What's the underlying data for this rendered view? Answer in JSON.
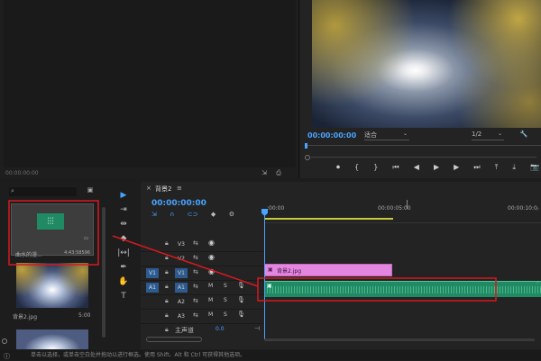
{
  "source_monitor": {
    "timecode": "00:00:00:00"
  },
  "program_monitor": {
    "timecode": "00:00:00:00",
    "fit": "适合",
    "resolution": "1/2",
    "wrench_glyph": "🔧",
    "transport": [
      {
        "name": "marker-icon",
        "glyph": "⏺"
      },
      {
        "name": "in-point-icon",
        "glyph": "{"
      },
      {
        "name": "out-point-icon",
        "glyph": "}"
      },
      {
        "name": "go-to-in-icon",
        "glyph": "⏮"
      },
      {
        "name": "step-back-icon",
        "glyph": "◀"
      },
      {
        "name": "play-icon",
        "glyph": "▶"
      },
      {
        "name": "step-forward-icon",
        "glyph": "▶"
      },
      {
        "name": "go-to-out-icon",
        "glyph": "⏭"
      },
      {
        "name": "lift-icon",
        "glyph": "⤒"
      },
      {
        "name": "extract-icon",
        "glyph": "⤓"
      },
      {
        "name": "export-frame-icon",
        "glyph": "📷"
      }
    ]
  },
  "project": {
    "search_placeholder": "",
    "items": [
      {
        "name": "曲水的漫...",
        "duration": "4:43:58596",
        "type": "audio"
      },
      {
        "name": "背景2.jpg",
        "duration": "5:00",
        "type": "image"
      }
    ]
  },
  "tools": [
    "▶",
    "⇥",
    "⇹",
    "◆",
    "|↔|",
    "✒",
    "✋",
    "T"
  ],
  "timeline": {
    "sequence_name": "背景2",
    "menu_glyph": "≡",
    "timecode": "00:00:00:00",
    "ruler": [
      ":00:00",
      "00:00:05:00",
      "00:00:10:0"
    ],
    "video_tracks": [
      {
        "label": "V3",
        "source": ""
      },
      {
        "label": "V2",
        "source": ""
      },
      {
        "label": "V1",
        "source": "V1"
      }
    ],
    "audio_tracks": [
      {
        "label": "A1",
        "source": "A1"
      },
      {
        "label": "A2",
        "source": ""
      },
      {
        "label": "A3",
        "source": ""
      }
    ],
    "master_label": "主声道",
    "master_value": "0.0",
    "video_clip": "背景2.jpg",
    "mute_label": "M",
    "solo_label": "S"
  },
  "status_text": "单击以选择，或单击空白处并拖动以进行框选。使用 Shift、Alt 和 Ctrl 可获得其他选项。",
  "colors": {
    "accent": "#4aa3ff",
    "video_clip": "#e386e0",
    "audio_clip": "#1f8a63",
    "highlight": "#d71920",
    "work_area": "#c7c93a"
  }
}
